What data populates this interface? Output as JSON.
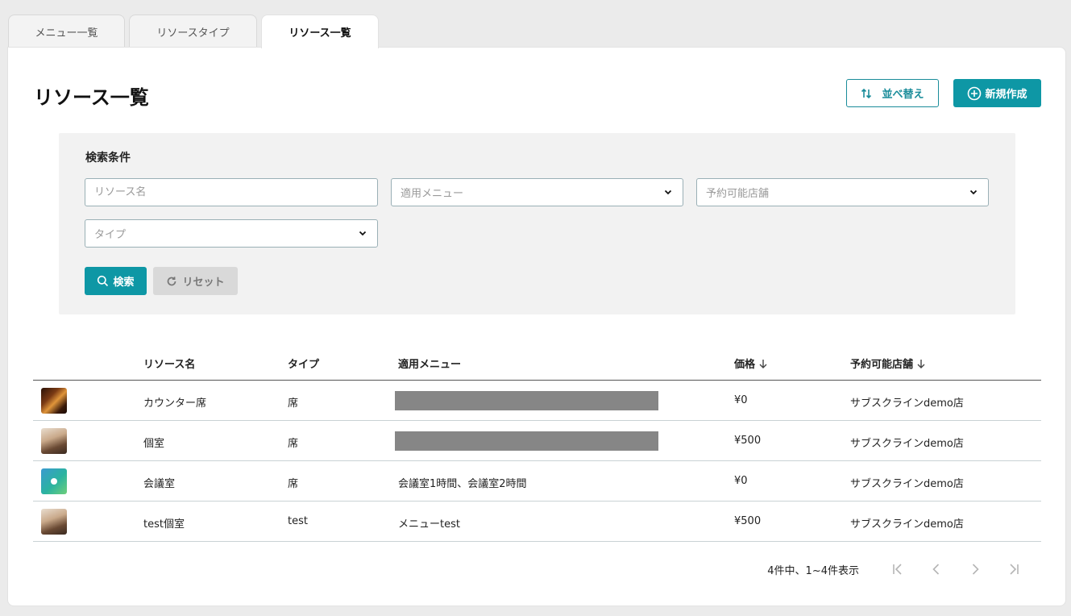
{
  "tabs": [
    {
      "label": "メニュー一覧",
      "active": false
    },
    {
      "label": "リソースタイプ",
      "active": false
    },
    {
      "label": "リソース一覧",
      "active": true
    }
  ],
  "page": {
    "title": "リソース一覧",
    "sort_button": "並べ替え",
    "new_button": "新規作成"
  },
  "search": {
    "title": "検索条件",
    "name_placeholder": "リソース名",
    "menu_placeholder": "適用メニュー",
    "store_placeholder": "予約可能店舗",
    "type_placeholder": "タイプ",
    "search_button": "検索",
    "reset_button": "リセット"
  },
  "table": {
    "headers": {
      "name": "リソース名",
      "type": "タイプ",
      "menu": "適用メニュー",
      "price": "価格",
      "store": "予約可能店舗"
    },
    "rows": [
      {
        "name": "カウンター席",
        "type": "席",
        "menu": "",
        "menu_redacted": true,
        "price": "¥0",
        "store": "サブスクラインdemo店",
        "thumb": "restaurant-counter-photo"
      },
      {
        "name": "個室",
        "type": "席",
        "menu": "",
        "menu_redacted": true,
        "price": "¥500",
        "store": "サブスクラインdemo店",
        "thumb": "private-room-photo"
      },
      {
        "name": "会議室",
        "type": "席",
        "menu": "会議室1時間、会議室2時間",
        "menu_redacted": false,
        "price": "¥0",
        "store": "サブスクラインdemo店",
        "thumb": "brand-logo-gradient"
      },
      {
        "name": "test個室",
        "type": "test",
        "menu": "メニューtest",
        "menu_redacted": false,
        "price": "¥500",
        "store": "サブスクラインdemo店",
        "thumb": "private-room-photo"
      }
    ]
  },
  "pagination": {
    "summary": "4件中、1~4件表示"
  },
  "colors": {
    "accent": "#0e97a5",
    "accent_border": "#1a8c9a"
  }
}
